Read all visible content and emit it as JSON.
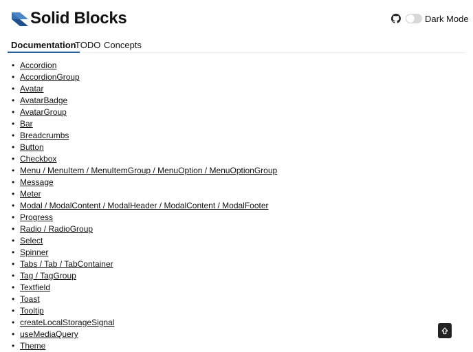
{
  "header": {
    "brand": "Solid Blocks",
    "logo_icon": "layers-icon",
    "github_icon": "github-icon",
    "dark_mode_label": "Dark Mode",
    "dark_mode_enabled": false
  },
  "tabs": [
    {
      "label": "Documentation",
      "active": true
    },
    {
      "label": "TODO",
      "active": false
    },
    {
      "label": "Concepts",
      "active": false
    }
  ],
  "components": [
    "Accordion",
    "AccordionGroup",
    "Avatar",
    "AvatarBadge",
    "AvatarGroup",
    "Bar",
    "Breadcrumbs",
    "Button",
    "Checkbox",
    "Menu / MenuItem / MenuItemGroup / MenuOption / MenuOptionGroup",
    "Message",
    "Meter",
    "Modal / ModalContent / ModalHeader / ModalContent / ModalFooter",
    "Progress",
    "Radio / RadioGroup",
    "Select",
    "Spinner",
    "Tabs / Tab / TabContainer",
    "Tag / TagGroup",
    "Textfield",
    "Toast",
    "Tooltip",
    "createLocalStorageSignal",
    "useMediaQuery",
    "Theme"
  ],
  "scroll_top_icon": "arrow-up-icon",
  "colors": {
    "logo_light": "#4a86c8",
    "logo_dark": "#1f4f8c",
    "tab_underline": "#2a5fa0",
    "scroll_button": "#222222"
  }
}
